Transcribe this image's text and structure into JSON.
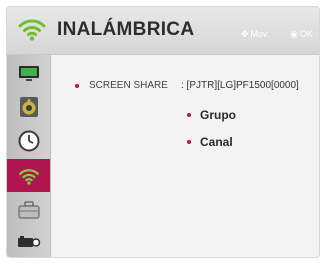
{
  "header": {
    "title": "INALÁMBRICA",
    "icon": "wifi-icon",
    "hints": {
      "move_label": "Mov.",
      "ok_label": "OK"
    }
  },
  "sidebar": {
    "active_index": 3,
    "items": [
      {
        "icon": "picture-icon"
      },
      {
        "icon": "speaker-icon"
      },
      {
        "icon": "clock-icon"
      },
      {
        "icon": "wifi-icon"
      },
      {
        "icon": "briefcase-icon"
      },
      {
        "icon": "camera-icon"
      }
    ]
  },
  "content": {
    "screen_share": {
      "label": "SCREEN SHARE",
      "value": ": [PJTR][LG]PF1500[0000]"
    },
    "options": [
      {
        "label": "Grupo"
      },
      {
        "label": "Canal"
      }
    ]
  },
  "colors": {
    "accent": "#b0154f",
    "wifi_green": "#6fbf2a"
  }
}
